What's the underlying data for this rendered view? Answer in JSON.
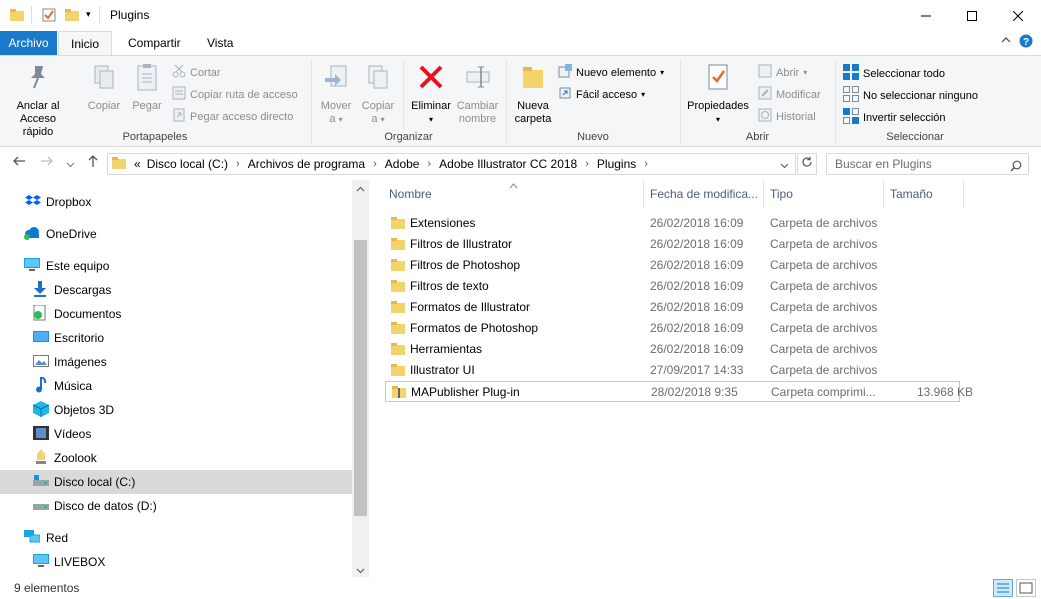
{
  "window": {
    "title": "Plugins",
    "minimize_icon": "minimize-icon",
    "maximize_icon": "maximize-icon",
    "close_icon": "close-icon"
  },
  "ribbon_tabs": [
    "Archivo",
    "Inicio",
    "Compartir",
    "Vista"
  ],
  "ribbon": {
    "portapapeles": {
      "label": "Portapapeles",
      "pin": "Anclar al\nAcceso rápido",
      "pin_line1": "Anclar al",
      "pin_line2": "Acceso rápido",
      "copy": "Copiar",
      "paste": "Pegar",
      "cut": "Cortar",
      "copy_path": "Copiar ruta de acceso",
      "paste_shortcut": "Pegar acceso directo"
    },
    "organizar": {
      "label": "Organizar",
      "move_line1": "Mover",
      "move_line2": "a",
      "copy_line1": "Copiar",
      "copy_line2": "a",
      "delete": "Eliminar",
      "rename_line1": "Cambiar",
      "rename_line2": "nombre"
    },
    "nuevo": {
      "label": "Nuevo",
      "new_folder_line1": "Nueva",
      "new_folder_line2": "carpeta",
      "new_item": "Nuevo elemento",
      "easy_access": "Fácil acceso"
    },
    "abrir": {
      "label": "Abrir",
      "properties": "Propiedades",
      "open": "Abrir",
      "edit": "Modificar",
      "history": "Historial"
    },
    "seleccionar": {
      "label": "Seleccionar",
      "select_all": "Seleccionar todo",
      "select_none": "No seleccionar ninguno",
      "invert": "Invertir selección"
    }
  },
  "address": {
    "prefix": "«",
    "crumbs": [
      "Disco local (C:)",
      "Archivos de programa",
      "Adobe",
      "Adobe Illustrator CC 2018",
      "Plugins"
    ],
    "search_placeholder": "Buscar en Plugins"
  },
  "nav": {
    "items": [
      {
        "label": "Dropbox",
        "icon": "dropbox-icon"
      },
      {
        "label": "OneDrive",
        "icon": "onedrive-icon"
      },
      {
        "label": "Este equipo",
        "icon": "computer-icon"
      },
      {
        "label": "Descargas",
        "icon": "download-icon"
      },
      {
        "label": "Documentos",
        "icon": "documents-icon"
      },
      {
        "label": "Escritorio",
        "icon": "desktop-icon"
      },
      {
        "label": "Imágenes",
        "icon": "images-icon"
      },
      {
        "label": "Música",
        "icon": "music-icon"
      },
      {
        "label": "Objetos 3D",
        "icon": "objects-3d-icon"
      },
      {
        "label": "Vídeos",
        "icon": "videos-icon"
      },
      {
        "label": "Zoolook",
        "icon": "drive-icon"
      },
      {
        "label": "Disco local (C:)",
        "icon": "drive-icon"
      },
      {
        "label": "Disco de datos (D:)",
        "icon": "drive-icon"
      },
      {
        "label": "Red",
        "icon": "network-icon"
      },
      {
        "label": "LIVEBOX",
        "icon": "computer-icon"
      }
    ]
  },
  "columns": [
    "Nombre",
    "Fecha de modifica...",
    "Tipo",
    "Tamaño"
  ],
  "files": [
    {
      "name": "Extensiones",
      "date": "26/02/2018 16:09",
      "type": "Carpeta de archivos",
      "size": ""
    },
    {
      "name": "Filtros de Illustrator",
      "date": "26/02/2018 16:09",
      "type": "Carpeta de archivos",
      "size": ""
    },
    {
      "name": "Filtros de Photoshop",
      "date": "26/02/2018 16:09",
      "type": "Carpeta de archivos",
      "size": ""
    },
    {
      "name": "Filtros de texto",
      "date": "26/02/2018 16:09",
      "type": "Carpeta de archivos",
      "size": ""
    },
    {
      "name": "Formatos de Illustrator",
      "date": "26/02/2018 16:09",
      "type": "Carpeta de archivos",
      "size": ""
    },
    {
      "name": "Formatos de Photoshop",
      "date": "26/02/2018 16:09",
      "type": "Carpeta de archivos",
      "size": ""
    },
    {
      "name": "Herramientas",
      "date": "26/02/2018 16:09",
      "type": "Carpeta de archivos",
      "size": ""
    },
    {
      "name": "Illustrator UI",
      "date": "27/09/2017 14:33",
      "type": "Carpeta de archivos",
      "size": ""
    },
    {
      "name": "MAPublisher Plug-in",
      "date": "28/02/2018 9:35",
      "type": "Carpeta comprimi...",
      "size": "13.968 KB"
    }
  ],
  "status": {
    "count": "9 elementos"
  },
  "colors": {
    "accent": "#1979ca",
    "selection": "#cce8ff",
    "delete_red": "#e81123",
    "folder": "#f4d36a"
  }
}
